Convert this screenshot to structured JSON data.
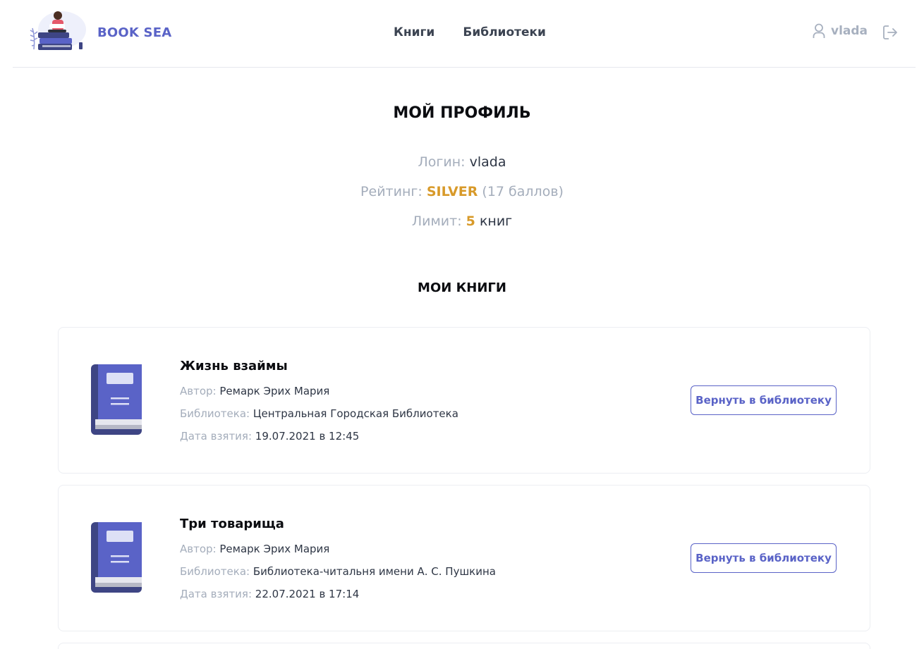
{
  "header": {
    "brand": "BOOK SEA",
    "nav": [
      "Книги",
      "Библиотеки"
    ],
    "username": "vlada",
    "icons": {
      "user": "user-icon",
      "logout": "logout-icon"
    }
  },
  "profile": {
    "title": "МОЙ ПРОФИЛЬ",
    "login_label": "Логин:",
    "login_value": "vlada",
    "rating_label": "Рейтинг:",
    "rating_value": "SILVER",
    "rating_points": "(17 баллов)",
    "limit_label": "Лимит:",
    "limit_value": "5",
    "limit_unit": "книг"
  },
  "books_section": {
    "title": "МОИ КНИГИ",
    "author_label": "Автор:",
    "library_label": "Библиотека:",
    "date_label": "Дата взятия:",
    "return_label": "Вернуть в библиотеку",
    "items": [
      {
        "title": "Жизнь взаймы",
        "author": "Ремарк Эрих Мария",
        "library": "Центральная Городская Библиотека",
        "date": "19.07.2021 в 12:45"
      },
      {
        "title": "Три товарища",
        "author": "Ремарк Эрих Мария",
        "library": "Библиотека-читальня имени А. С. Пушкина",
        "date": "22.07.2021 в 17:14"
      }
    ]
  },
  "colors": {
    "accent": "#5a63c7",
    "gold": "#d89a2a",
    "muted": "#a4adbb",
    "book_cover": "#5a63c7"
  }
}
